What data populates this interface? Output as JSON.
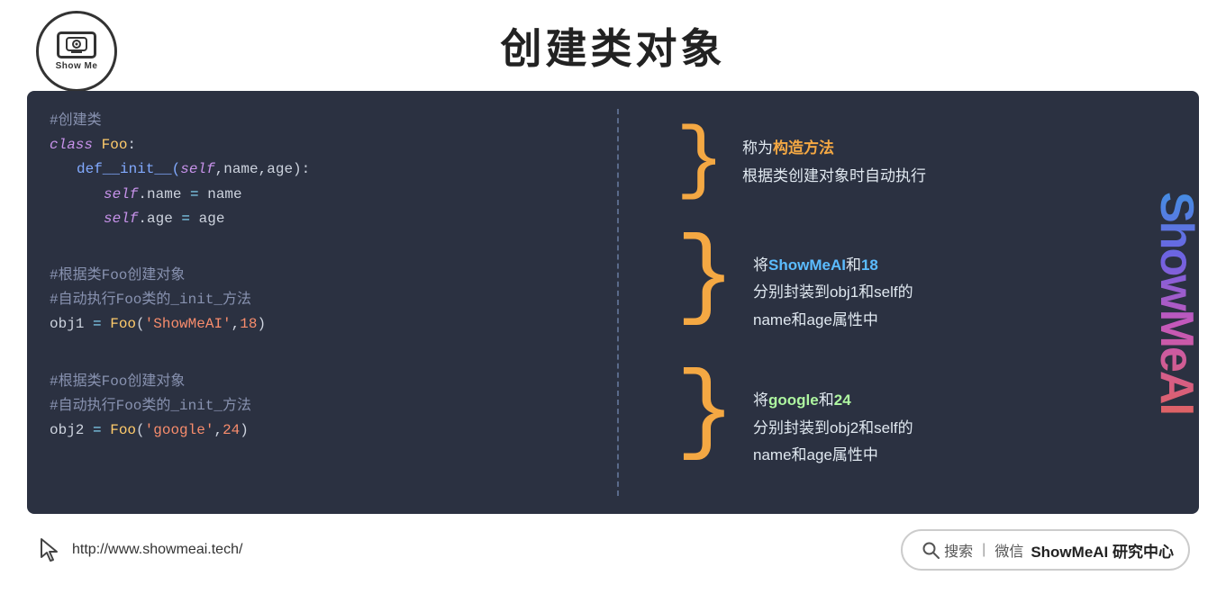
{
  "header": {
    "title": "创建类对象",
    "logo_text": "ShowMe AI",
    "logo_label": "Show Me"
  },
  "brand_watermark": "ShowMeAI",
  "code": {
    "block1": {
      "comment": "#创建类",
      "line1": "class Foo:",
      "line2": "    def__init__(self,name,age):",
      "line3": "        self.name = name",
      "line4": "        self.age = age"
    },
    "block2": {
      "comment1": "#根据类Foo创建对象",
      "comment2": "#自动执行Foo类的_init_方法",
      "line1": "obj1 = Foo('ShowMeAI',18)"
    },
    "block3": {
      "comment1": "#根据类Foo创建对象",
      "comment2": "#自动执行Foo类的_init_方法",
      "line1": "obj2 = Foo('google',24)"
    }
  },
  "explanations": {
    "item1": {
      "brace": "}",
      "line1": "称为",
      "highlight1": "构造方法",
      "line2": "根据类创建对象时自动执行"
    },
    "item2": {
      "brace": "}",
      "line1": "将",
      "highlight1": "ShowMeAI",
      "line1b": "和",
      "highlight2": "18",
      "line2": "分别封装到obj1和self的",
      "line3": "name和age属性中"
    },
    "item3": {
      "brace": "}",
      "line1": "将",
      "highlight1": "google",
      "line1b": "和",
      "highlight2": "24",
      "line2": "分别封装到obj2和self的",
      "line3": "name和age属性中"
    }
  },
  "footer": {
    "url": "http://www.showmeai.tech/",
    "search_placeholder": "搜索 | 微信  ShowMeAI 研究中心"
  }
}
